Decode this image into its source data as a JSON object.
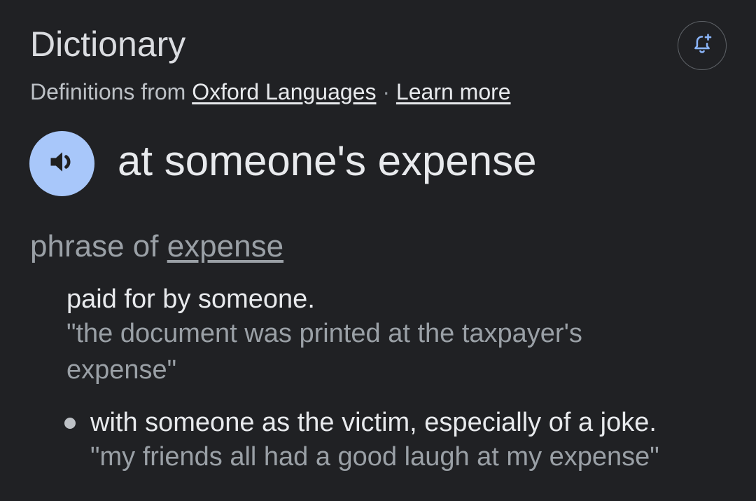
{
  "header": {
    "title": "Dictionary",
    "alert_icon": "bell-plus-icon"
  },
  "source": {
    "prefix": "Definitions from ",
    "source_link": "Oxford Languages",
    "separator": " · ",
    "learn_more": "Learn more"
  },
  "entry": {
    "speaker_icon": "speaker-icon",
    "headword": "at someone's expense",
    "pos_prefix": "phrase of ",
    "pos_link": "expense"
  },
  "senses": [
    {
      "definition": "paid for by someone.",
      "example": "\"the document was printed at the taxpayer's expense\""
    },
    {
      "definition": "with someone as the victim, especially of a joke.",
      "example": "\"my friends all had a good laugh at my expense\""
    }
  ],
  "colors": {
    "background": "#202124",
    "speaker_button": "#a8c7fa",
    "bell_icon": "#8ab4f8"
  }
}
